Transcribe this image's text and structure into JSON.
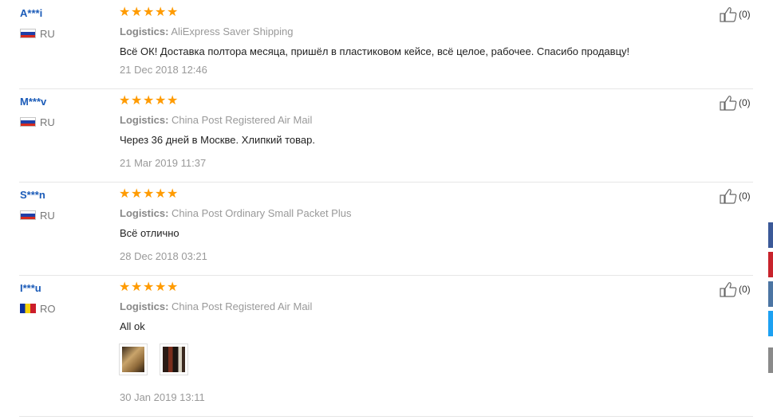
{
  "reviews": [
    {
      "user": "A***i",
      "country": "RU",
      "flag": "ru",
      "rating": 5,
      "logistics_label": "Logistics:",
      "logistics": "AliExpress Saver Shipping",
      "text": "Всё ОК! Доставка полтора месяца, пришёл в пластиковом кейсе, всё целое, рабочее. Спасибо продавцу!",
      "date": "21 Dec 2018 12:46",
      "helpful": "(0)",
      "photos": []
    },
    {
      "user": "M***v",
      "country": "RU",
      "flag": "ru",
      "rating": 5,
      "logistics_label": "Logistics:",
      "logistics": "China Post Registered Air Mail",
      "text": "Через 36 дней в Москве. Хлипкий товар.",
      "date": "21 Mar 2019 11:37",
      "helpful": "(0)",
      "photos": []
    },
    {
      "user": "S***n",
      "country": "RU",
      "flag": "ru",
      "rating": 5,
      "logistics_label": "Logistics:",
      "logistics": "China Post Ordinary Small Packet Plus",
      "text": "Всё отлично",
      "date": "28 Dec 2018 03:21",
      "helpful": "(0)",
      "photos": []
    },
    {
      "user": "I***u",
      "country": "RO",
      "flag": "ro",
      "rating": 5,
      "logistics_label": "Logistics:",
      "logistics": "China Post Registered Air Mail",
      "text": "All ok",
      "date": "30 Jan 2019 13:11",
      "helpful": "(0)",
      "photos": [
        "review-photo-1",
        "review-photo-2"
      ]
    }
  ],
  "side_share_colors": [
    "#3b5998",
    "#c8232c",
    "#4c75a3",
    "#1da1f2",
    "#8a8a8a"
  ],
  "colors": {
    "star": "#ff9b00",
    "username": "#1b5bb8"
  }
}
